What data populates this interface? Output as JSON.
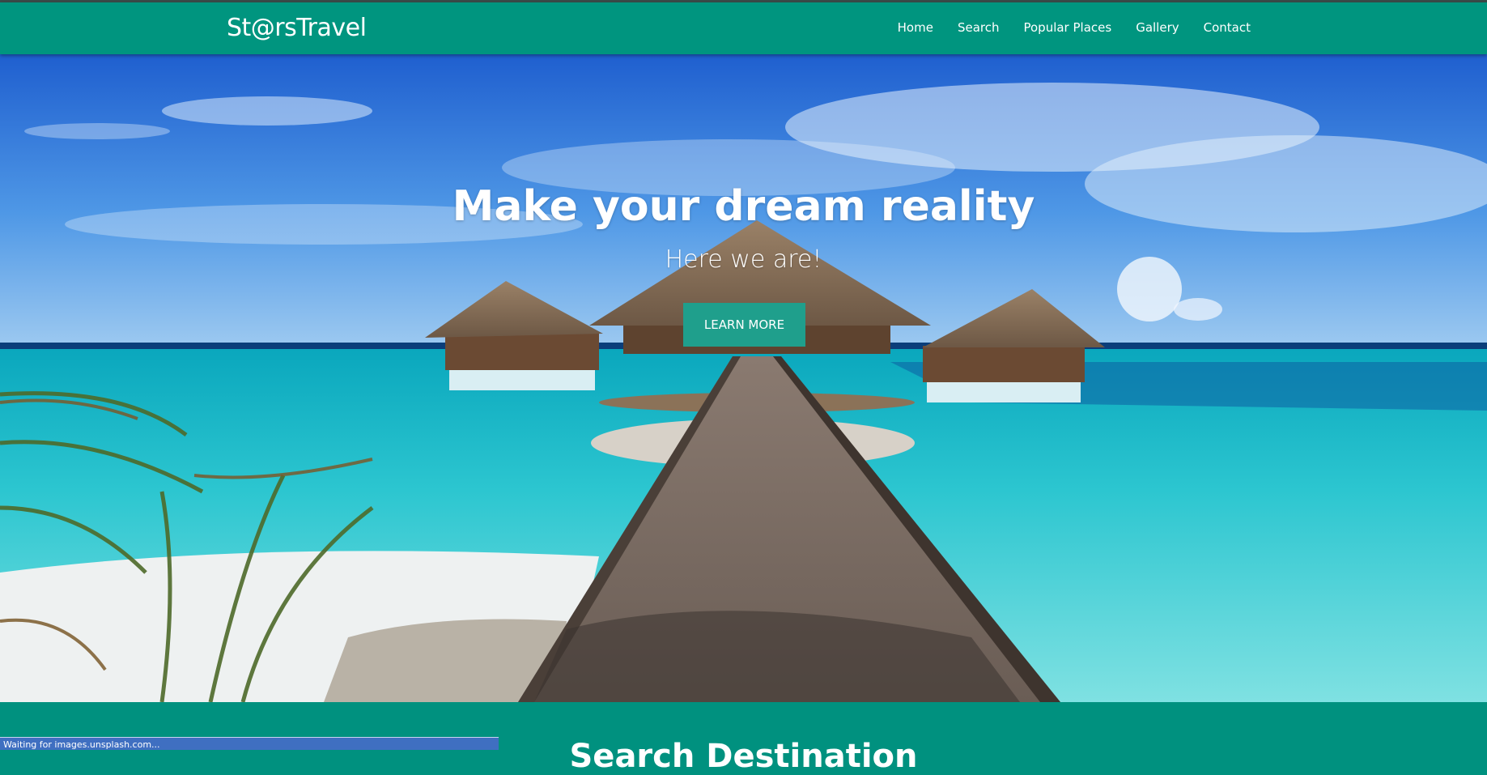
{
  "navbar": {
    "brand": "St@rsTravel",
    "links": [
      "Home",
      "Search",
      "Popular Places",
      "Gallery",
      "Contact"
    ]
  },
  "hero": {
    "title": "Make your dream reality",
    "subtitle": "Here we are!",
    "button_label": "LEARN MORE",
    "image": "tropical-overwater-bungalows-icon"
  },
  "section": {
    "title": "Search Destination"
  },
  "status": {
    "text": "Waiting for images.unsplash.com..."
  },
  "colors": {
    "brand_teal": "#00957f",
    "button_teal": "#1f9f8c",
    "status_blue": "#3f6fc1"
  }
}
